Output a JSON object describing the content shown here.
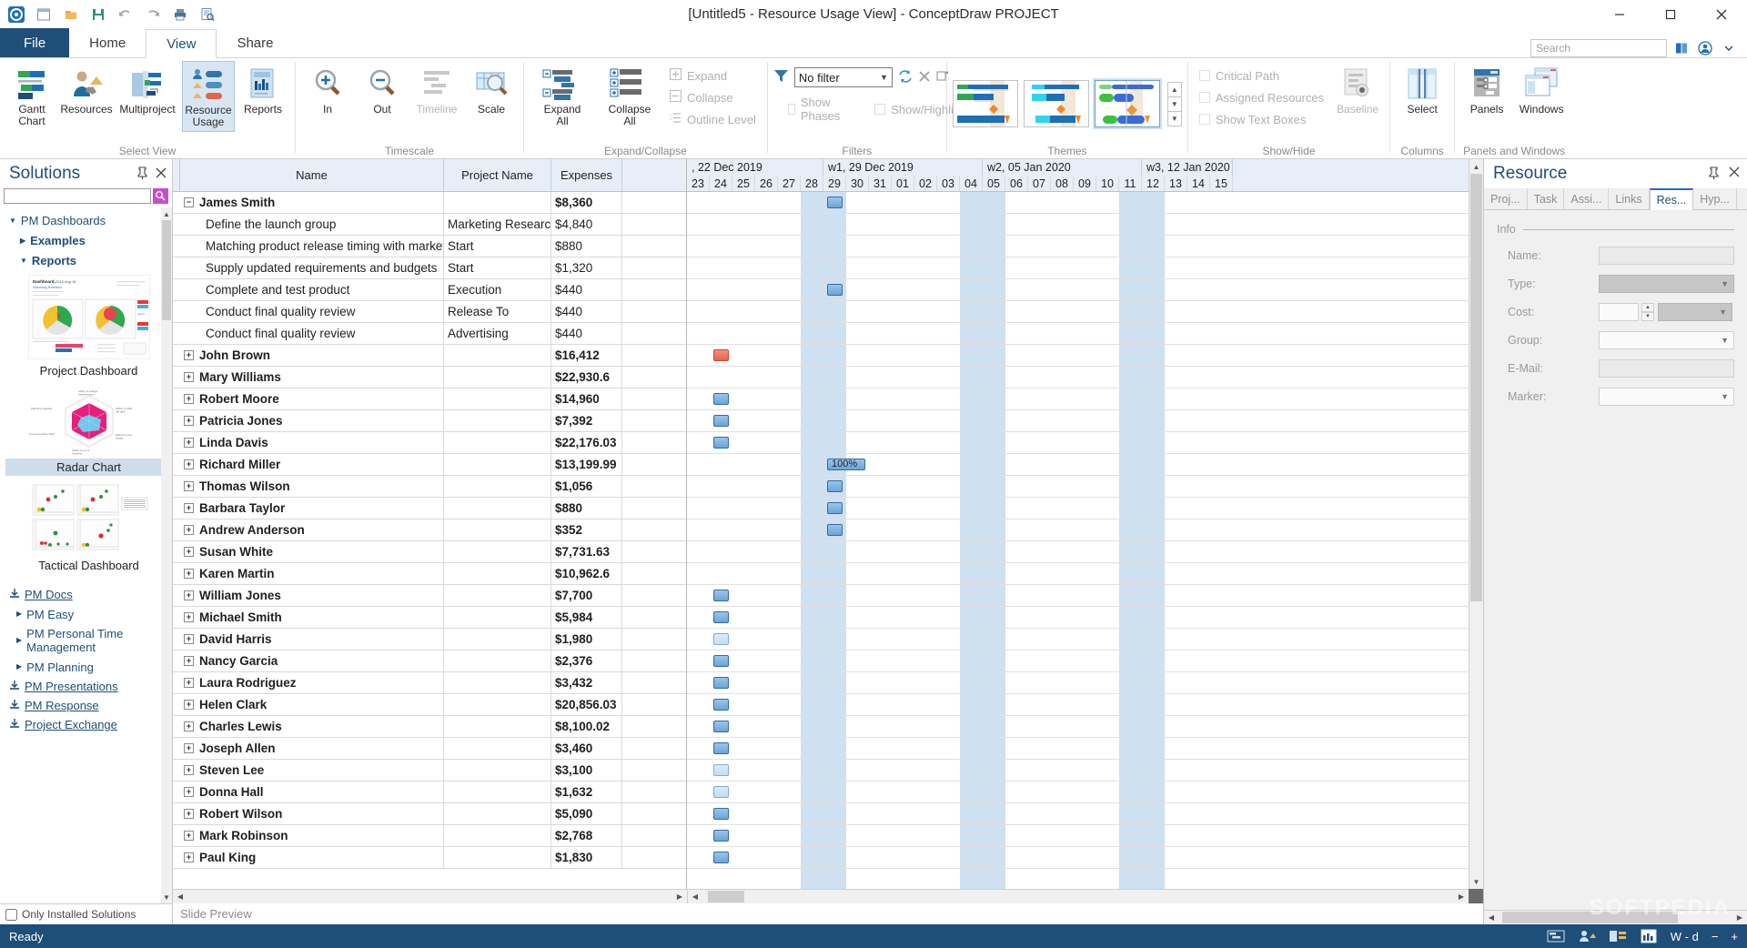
{
  "window": {
    "title": "[Untitled5 - Resource Usage View] - ConceptDraw PROJECT",
    "minimize": "–",
    "maximize": "□",
    "close": "✕"
  },
  "quick_access": [
    {
      "name": "app-logo-icon",
      "label": "◎"
    },
    {
      "name": "new-document-icon",
      "label": "▤"
    },
    {
      "name": "open-folder-icon",
      "label": "▰"
    },
    {
      "name": "save-icon",
      "label": "▣"
    },
    {
      "name": "undo-icon",
      "label": "↶"
    },
    {
      "name": "redo-icon",
      "label": "↷"
    },
    {
      "name": "print-icon",
      "label": "🖶"
    },
    {
      "name": "print-preview-icon",
      "label": "▤"
    }
  ],
  "tabs": [
    {
      "id": "file",
      "label": "File"
    },
    {
      "id": "home",
      "label": "Home"
    },
    {
      "id": "view",
      "label": "View"
    },
    {
      "id": "share",
      "label": "Share"
    }
  ],
  "active_tab": "view",
  "search": {
    "placeholder": "Search"
  },
  "ribbon": {
    "groups": [
      {
        "name": "select-view",
        "label": "Select View",
        "buttons": [
          {
            "id": "gantt-chart",
            "label": "Gantt\nChart",
            "l1": "Gantt",
            "l2": "Chart",
            "selected": false
          },
          {
            "id": "resources",
            "label": "Resources",
            "l1": "Resources",
            "l2": "",
            "selected": false
          },
          {
            "id": "multiproject",
            "label": "Multiproject",
            "l1": "Multiproject",
            "l2": "",
            "selected": false
          },
          {
            "id": "resource-usage",
            "label": "Resource Usage",
            "l1": "Resource",
            "l2": "Usage",
            "selected": true
          },
          {
            "id": "reports",
            "label": "Reports",
            "l1": "Reports",
            "l2": "",
            "selected": false
          }
        ]
      },
      {
        "name": "timescale",
        "label": "Timescale",
        "buttons": [
          {
            "id": "zoom-in",
            "label": "In",
            "l1": "In",
            "l2": "",
            "disabled": false
          },
          {
            "id": "zoom-out",
            "label": "Out",
            "l1": "Out",
            "l2": "",
            "disabled": false
          },
          {
            "id": "timeline",
            "label": "Timeline",
            "l1": "Timeline",
            "l2": "",
            "disabled": true
          },
          {
            "id": "scale",
            "label": "Scale",
            "l1": "Scale",
            "l2": "",
            "disabled": false
          }
        ]
      },
      {
        "name": "expand-collapse",
        "label": "Expand/Collapse",
        "buttons": [
          {
            "id": "expand-all",
            "label": "Expand All",
            "l1": "Expand",
            "l2": "All"
          },
          {
            "id": "collapse-all",
            "label": "Collapse All",
            "l1": "Collapse",
            "l2": "All"
          }
        ],
        "small_buttons": [
          {
            "id": "expand",
            "label": "Expand",
            "disabled": true
          },
          {
            "id": "collapse",
            "label": "Collapse",
            "disabled": true
          },
          {
            "id": "outline-level",
            "label": "Outline Level",
            "disabled": true
          }
        ]
      },
      {
        "name": "filters",
        "label": "Filters",
        "filter_value": "No filter",
        "small_buttons": [
          {
            "id": "show-phases",
            "label": "Show Phases",
            "disabled": true
          },
          {
            "id": "show-highlight",
            "label": "Show/Highlight",
            "disabled": true
          }
        ]
      },
      {
        "name": "themes",
        "label": "Themes",
        "items": [
          {
            "id": "theme-1",
            "selected": false
          },
          {
            "id": "theme-2",
            "selected": false
          },
          {
            "id": "theme-3",
            "selected": true
          }
        ]
      },
      {
        "name": "show-hide",
        "label": "Show/Hide",
        "small_buttons": [
          {
            "id": "critical-path",
            "label": "Critical Path",
            "disabled": true
          },
          {
            "id": "assigned-resources",
            "label": "Assigned Resources",
            "disabled": true
          },
          {
            "id": "show-text-boxes",
            "label": "Show Text Boxes",
            "disabled": true
          }
        ],
        "buttons": [
          {
            "id": "baseline",
            "label": "Baseline",
            "l1": "Baseline",
            "l2": "",
            "disabled": true
          }
        ]
      },
      {
        "name": "columns",
        "label": "Columns",
        "buttons": [
          {
            "id": "select",
            "label": "Select",
            "l1": "Select",
            "l2": ""
          }
        ]
      },
      {
        "name": "panels-and-windows",
        "label": "Panels and Windows",
        "buttons": [
          {
            "id": "panels",
            "label": "Panels",
            "l1": "Panels",
            "l2": ""
          },
          {
            "id": "windows",
            "label": "Windows",
            "l1": "Windows",
            "l2": ""
          }
        ]
      }
    ]
  },
  "solutions": {
    "title": "Solutions",
    "search_value": "",
    "tree": [
      {
        "id": "pm-dashboards",
        "label": "PM Dashboards",
        "expanded": true,
        "level": 0,
        "bold": false
      },
      {
        "id": "examples",
        "label": "Examples",
        "expanded": false,
        "level": 1,
        "bold": true
      },
      {
        "id": "reports",
        "label": "Reports",
        "expanded": true,
        "level": 1,
        "bold": true
      }
    ],
    "thumbnails": [
      {
        "id": "project-dashboard",
        "caption": "Project Dashboard",
        "selected": false
      },
      {
        "id": "radar-chart",
        "caption": "Radar Chart",
        "selected": true
      },
      {
        "id": "tactical-dashboard",
        "caption": "Tactical Dashboard",
        "selected": false
      }
    ],
    "links": [
      {
        "id": "pm-docs",
        "label": "PM Docs",
        "type": "download",
        "underline": true
      },
      {
        "id": "pm-easy",
        "label": "PM Easy",
        "type": "tree"
      },
      {
        "id": "pm-personal-time-management",
        "label": "PM Personal Time Management",
        "type": "tree"
      },
      {
        "id": "pm-planning",
        "label": "PM Planning",
        "type": "tree"
      },
      {
        "id": "pm-presentations",
        "label": "PM Presentations",
        "type": "download",
        "underline": true
      },
      {
        "id": "pm-response",
        "label": "PM Response",
        "type": "download",
        "underline": true
      },
      {
        "id": "project-exchange",
        "label": "Project Exchange",
        "type": "download",
        "underline": true
      }
    ],
    "only_installed": "Only Installed Solutions",
    "slide_preview": "Slide Preview"
  },
  "table": {
    "columns": [
      {
        "id": "name",
        "label": "Name"
      },
      {
        "id": "project_name",
        "label": "Project Name"
      },
      {
        "id": "expenses",
        "label": "Expenses"
      }
    ],
    "rows": [
      {
        "name": "James Smith",
        "project": "",
        "expenses": "$8,360",
        "group": true,
        "expander": "−",
        "indent": false
      },
      {
        "name": "Define the launch group",
        "project": "Marketing Research",
        "expenses": "$4,840",
        "group": false,
        "expander": "",
        "indent": true
      },
      {
        "name": "Matching product release timing with marketing",
        "project": "Start",
        "expenses": "$880",
        "group": false,
        "expander": "",
        "indent": true
      },
      {
        "name": "Supply updated requirements and budgets",
        "project": "Start",
        "expenses": "$1,320",
        "group": false,
        "expander": "",
        "indent": true
      },
      {
        "name": "Complete and test product",
        "project": "Execution",
        "expenses": "$440",
        "group": false,
        "expander": "",
        "indent": true
      },
      {
        "name": "Conduct final quality review",
        "project": "Release To",
        "expenses": "$440",
        "group": false,
        "expander": "",
        "indent": true
      },
      {
        "name": "Conduct final quality review",
        "project": "Advertising",
        "expenses": "$440",
        "group": false,
        "expander": "",
        "indent": true
      },
      {
        "name": "John Brown",
        "project": "",
        "expenses": "$16,412",
        "group": true,
        "expander": "+",
        "indent": false
      },
      {
        "name": "Mary Williams",
        "project": "",
        "expenses": "$22,930.6",
        "group": true,
        "expander": "+",
        "indent": false
      },
      {
        "name": "Robert Moore",
        "project": "",
        "expenses": "$14,960",
        "group": true,
        "expander": "+",
        "indent": false
      },
      {
        "name": "Patricia Jones",
        "project": "",
        "expenses": "$7,392",
        "group": true,
        "expander": "+",
        "indent": false
      },
      {
        "name": "Linda Davis",
        "project": "",
        "expenses": "$22,176.03",
        "group": true,
        "expander": "+",
        "indent": false
      },
      {
        "name": "Richard Miller",
        "project": "",
        "expenses": "$13,199.99",
        "group": true,
        "expander": "+",
        "indent": false
      },
      {
        "name": "Thomas Wilson",
        "project": "",
        "expenses": "$1,056",
        "group": true,
        "expander": "+",
        "indent": false
      },
      {
        "name": "Barbara Taylor",
        "project": "",
        "expenses": "$880",
        "group": true,
        "expander": "+",
        "indent": false
      },
      {
        "name": "Andrew Anderson",
        "project": "",
        "expenses": "$352",
        "group": true,
        "expander": "+",
        "indent": false
      },
      {
        "name": "Susan White",
        "project": "",
        "expenses": "$7,731.63",
        "group": true,
        "expander": "+",
        "indent": false
      },
      {
        "name": "Karen Martin",
        "project": "",
        "expenses": "$10,962.6",
        "group": true,
        "expander": "+",
        "indent": false
      },
      {
        "name": "William Jones",
        "project": "",
        "expenses": "$7,700",
        "group": true,
        "expander": "+",
        "indent": false
      },
      {
        "name": "Michael Smith",
        "project": "",
        "expenses": "$5,984",
        "group": true,
        "expander": "+",
        "indent": false
      },
      {
        "name": "David Harris",
        "project": "",
        "expenses": "$1,980",
        "group": true,
        "expander": "+",
        "indent": false
      },
      {
        "name": "Nancy Garcia",
        "project": "",
        "expenses": "$2,376",
        "group": true,
        "expander": "+",
        "indent": false
      },
      {
        "name": "Laura Rodriguez",
        "project": "",
        "expenses": "$3,432",
        "group": true,
        "expander": "+",
        "indent": false
      },
      {
        "name": "Helen Clark",
        "project": "",
        "expenses": "$20,856.03",
        "group": true,
        "expander": "+",
        "indent": false
      },
      {
        "name": "Charles Lewis",
        "project": "",
        "expenses": "$8,100.02",
        "group": true,
        "expander": "+",
        "indent": false
      },
      {
        "name": "Joseph Allen",
        "project": "",
        "expenses": "$3,460",
        "group": true,
        "expander": "+",
        "indent": false
      },
      {
        "name": "Steven Lee",
        "project": "",
        "expenses": "$3,100",
        "group": true,
        "expander": "+",
        "indent": false
      },
      {
        "name": "Donna Hall",
        "project": "",
        "expenses": "$1,632",
        "group": true,
        "expander": "+",
        "indent": false
      },
      {
        "name": "Robert Wilson",
        "project": "",
        "expenses": "$5,090",
        "group": true,
        "expander": "+",
        "indent": false
      },
      {
        "name": "Mark Robinson",
        "project": "",
        "expenses": "$2,768",
        "group": true,
        "expander": "+",
        "indent": false
      },
      {
        "name": "Paul King",
        "project": "",
        "expenses": "$1,830",
        "group": true,
        "expander": "+",
        "indent": false
      }
    ]
  },
  "gantt": {
    "weeks": [
      {
        "label": ", 22 Dec 2019",
        "days": 6
      },
      {
        "label": "w1, 29 Dec 2019",
        "days": 7
      },
      {
        "label": "w2, 05 Jan 2020",
        "days": 7
      },
      {
        "label": "w3, 12 Jan 2020",
        "days": 4
      }
    ],
    "days": [
      "23",
      "24",
      "25",
      "26",
      "27",
      "28",
      "29",
      "30",
      "31",
      "01",
      "02",
      "03",
      "04",
      "05",
      "06",
      "07",
      "08",
      "09",
      "10",
      "11",
      "12",
      "13",
      "14",
      "15"
    ],
    "weekend_columns": [
      5,
      6,
      12,
      13,
      19,
      20
    ],
    "bars": [
      {
        "row": 0,
        "start": 6,
        "span": 1,
        "style": "normal",
        "label": ""
      },
      {
        "row": 4,
        "start": 6,
        "span": 1,
        "style": "normal",
        "label": ""
      },
      {
        "row": 7,
        "start": 1,
        "span": 1,
        "style": "red",
        "label": ""
      },
      {
        "row": 9,
        "start": 1,
        "span": 1,
        "style": "normal",
        "label": ""
      },
      {
        "row": 10,
        "start": 1,
        "span": 1,
        "style": "normal",
        "label": ""
      },
      {
        "row": 11,
        "start": 1,
        "span": 1,
        "style": "normal",
        "label": ""
      },
      {
        "row": 12,
        "start": 6,
        "span": 2,
        "style": "normal",
        "label": "100%"
      },
      {
        "row": 13,
        "start": 6,
        "span": 1,
        "style": "normal",
        "label": ""
      },
      {
        "row": 14,
        "start": 6,
        "span": 1,
        "style": "normal",
        "label": ""
      },
      {
        "row": 15,
        "start": 6,
        "span": 1,
        "style": "normal",
        "label": ""
      },
      {
        "row": 18,
        "start": 1,
        "span": 1,
        "style": "normal",
        "label": ""
      },
      {
        "row": 19,
        "start": 1,
        "span": 1,
        "style": "normal",
        "label": ""
      },
      {
        "row": 20,
        "start": 1,
        "span": 1,
        "style": "pale",
        "label": ""
      },
      {
        "row": 21,
        "start": 1,
        "span": 1,
        "style": "normal",
        "label": ""
      },
      {
        "row": 22,
        "start": 1,
        "span": 1,
        "style": "normal",
        "label": ""
      },
      {
        "row": 23,
        "start": 1,
        "span": 1,
        "style": "normal",
        "label": ""
      },
      {
        "row": 24,
        "start": 1,
        "span": 1,
        "style": "normal",
        "label": ""
      },
      {
        "row": 25,
        "start": 1,
        "span": 1,
        "style": "normal",
        "label": ""
      },
      {
        "row": 26,
        "start": 1,
        "span": 1,
        "style": "pale",
        "label": ""
      },
      {
        "row": 27,
        "start": 1,
        "span": 1,
        "style": "pale",
        "label": ""
      },
      {
        "row": 28,
        "start": 1,
        "span": 1,
        "style": "normal",
        "label": ""
      },
      {
        "row": 29,
        "start": 1,
        "span": 1,
        "style": "normal",
        "label": ""
      },
      {
        "row": 30,
        "start": 1,
        "span": 1,
        "style": "normal",
        "label": ""
      }
    ]
  },
  "resource_panel": {
    "title": "Resource",
    "tabs": [
      {
        "id": "proj",
        "label": "Proj...",
        "active": false
      },
      {
        "id": "task",
        "label": "Task",
        "active": false
      },
      {
        "id": "assi",
        "label": "Assi...",
        "active": false
      },
      {
        "id": "links",
        "label": "Links",
        "active": false
      },
      {
        "id": "res",
        "label": "Res...",
        "active": true
      },
      {
        "id": "hyp",
        "label": "Hyp...",
        "active": false
      }
    ],
    "section_label": "Info",
    "fields": [
      {
        "id": "name",
        "label": "Name:",
        "value": "",
        "kind": "text"
      },
      {
        "id": "type",
        "label": "Type:",
        "value": "",
        "kind": "select-grey"
      },
      {
        "id": "cost",
        "label": "Cost:",
        "value": "",
        "kind": "cost"
      },
      {
        "id": "group",
        "label": "Group:",
        "value": "",
        "kind": "select-white"
      },
      {
        "id": "email",
        "label": "E-Mail:",
        "value": "",
        "kind": "text"
      },
      {
        "id": "marker",
        "label": "Marker:",
        "value": "",
        "kind": "select-white"
      }
    ]
  },
  "statusbar": {
    "status": "Ready",
    "zoom_label": "W - d",
    "icons": [
      {
        "id": "view-gantt-icon",
        "glyph": "▤"
      },
      {
        "id": "view-resources-icon",
        "glyph": "👤"
      },
      {
        "id": "view-multiproject-icon",
        "glyph": "▦"
      },
      {
        "id": "view-report-icon",
        "glyph": "▥"
      }
    ],
    "zoom_out": "−",
    "zoom_in": "+"
  },
  "watermark": "SOFTPEDIA"
}
